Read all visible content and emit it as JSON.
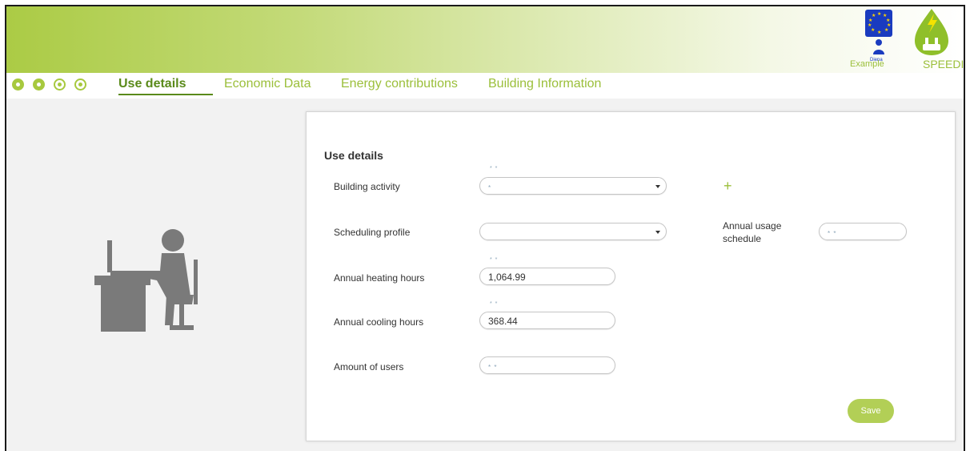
{
  "header": {
    "example_label": "Example",
    "diena_label": "Diena",
    "brand_name": "SPEEDIER"
  },
  "nav": {
    "icons": [
      "home-icon",
      "apple-icon",
      "lightbulb-icon",
      "star-icon"
    ],
    "tabs": [
      {
        "label": "Use details",
        "active": true
      },
      {
        "label": "Economic Data",
        "active": false
      },
      {
        "label": "Energy contributions",
        "active": false
      },
      {
        "label": "Building Information",
        "active": false
      }
    ]
  },
  "form": {
    "title": "Use details",
    "required_marker": "* *",
    "building_activity": {
      "label": "Building activity",
      "value": "*"
    },
    "scheduling_profile": {
      "label": "Scheduling profile",
      "value": ""
    },
    "annual_usage_schedule": {
      "label": "Annual usage schedule",
      "value": "* *"
    },
    "annual_heating_hours": {
      "label": "Annual heating hours",
      "value": "1,064.99"
    },
    "annual_cooling_hours": {
      "label": "Annual cooling hours",
      "value": "368.44"
    },
    "amount_of_users": {
      "label": "Amount of users",
      "value": "* *"
    },
    "add_symbol": "+",
    "save_label": "Save"
  },
  "colors": {
    "accent": "#a7c93e",
    "active_tab": "#5a8a1a",
    "save_button": "#b2cf56"
  }
}
